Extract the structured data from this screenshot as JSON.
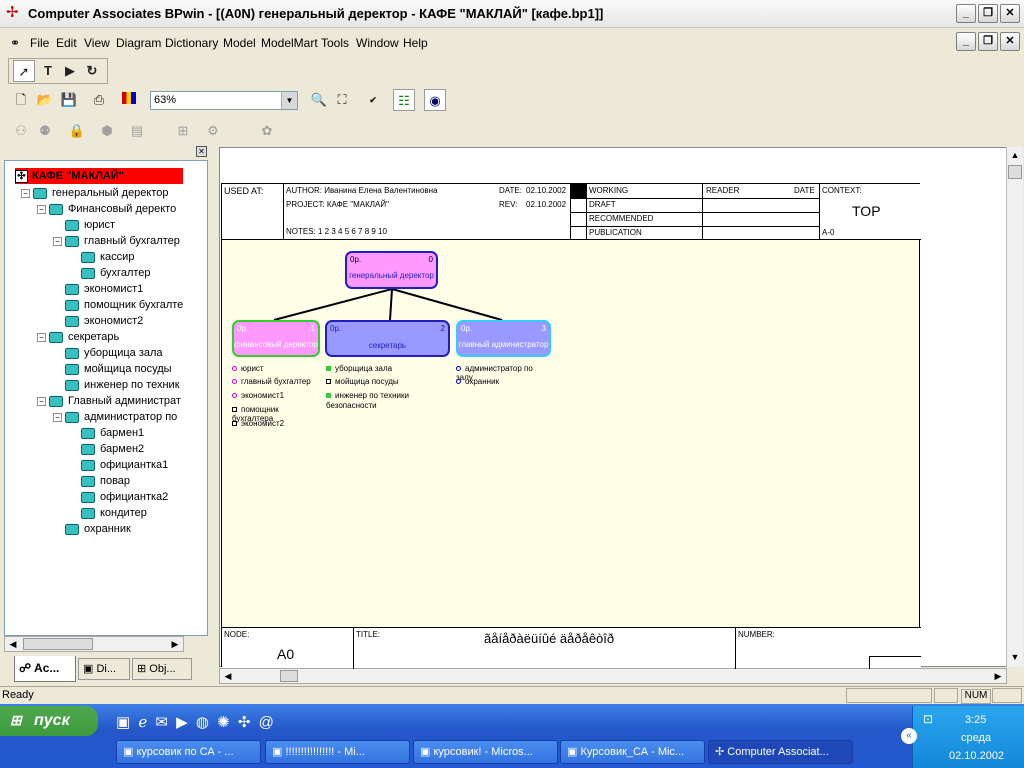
{
  "window": {
    "title": "Computer Associates BPwin - [(A0N) генеральный деректор - КАФЕ \"МАКЛАЙ\"  [кафе.bp1]]"
  },
  "menu": [
    "File",
    "Edit",
    "View",
    "Diagram",
    "Dictionary",
    "Model",
    "ModelMart",
    "Tools",
    "Window",
    "Help"
  ],
  "toolbar": {
    "zoom": "63%"
  },
  "tree": {
    "root": "КАФЕ \"МАКЛАЙ\"",
    "items": [
      {
        "label": "генеральный деректор",
        "level": 1,
        "exp": "-"
      },
      {
        "label": "Финансовый деректо",
        "level": 2,
        "exp": "-"
      },
      {
        "label": "юрист",
        "level": 3
      },
      {
        "label": "главный бухгалтер",
        "level": 3,
        "exp": "-"
      },
      {
        "label": "кассир",
        "level": 4
      },
      {
        "label": "бухгалтер",
        "level": 4
      },
      {
        "label": "экономист1",
        "level": 3
      },
      {
        "label": "помощник бухгалте",
        "level": 3
      },
      {
        "label": "экономист2",
        "level": 3
      },
      {
        "label": "секретарь",
        "level": 2,
        "exp": "-"
      },
      {
        "label": "уборщица зала",
        "level": 3
      },
      {
        "label": "мойщица посуды",
        "level": 3
      },
      {
        "label": "инженер по техник",
        "level": 3
      },
      {
        "label": "Главный администрат",
        "level": 2,
        "exp": "-"
      },
      {
        "label": "администратор по",
        "level": 3,
        "exp": "-"
      },
      {
        "label": "бармен1",
        "level": 4
      },
      {
        "label": "бармен2",
        "level": 4
      },
      {
        "label": "официантка1",
        "level": 4
      },
      {
        "label": "повар",
        "level": 4
      },
      {
        "label": "официантка2",
        "level": 4
      },
      {
        "label": "кондитер",
        "level": 4
      },
      {
        "label": "охранник",
        "level": 3
      }
    ],
    "tabs": [
      "Ac...",
      "Di...",
      "Obj..."
    ]
  },
  "frame": {
    "used_at": "USED AT:",
    "author": "AUTHOR:  Иванина Елена Валентиновна",
    "project": "PROJECT:  КАФЕ \"МАКЛАЙ\"",
    "date_label": "DATE:",
    "date": "02.10.2002",
    "rev_label": "REV:",
    "rev": "02.10.2002",
    "notes": "NOTES:  1  2  3  4  5  6  7  8  9  10",
    "status": [
      "WORKING",
      "DRAFT",
      "RECOMMENDED",
      "PUBLICATION"
    ],
    "reader": "READER",
    "reader_date": "DATE",
    "context": "CONTEXT:",
    "top": "TOP",
    "a0ref": "A-0",
    "node_label": "NODE:",
    "node": "A0",
    "title_label": "TITLE:",
    "title": "ãåíåðàëüíûé äåðåêòîð",
    "number_label": "NUMBER:"
  },
  "diagram": {
    "top_box": {
      "num": "0р.",
      "idx": "0",
      "label": "генеральный деректор"
    },
    "boxes": [
      {
        "num": "0р.",
        "idx": "1",
        "label": "финансовый деректор"
      },
      {
        "num": "0р.",
        "idx": "2",
        "label": "секретарь"
      },
      {
        "num": "0р.",
        "idx": "3",
        "label": "главный администратор"
      }
    ],
    "list1": [
      "юрист",
      "главный бухгалтер",
      "экономист1",
      "помощник бухгалтера",
      "экономист2"
    ],
    "list2": [
      "уборщица зала",
      "мойщица посуды",
      "инженер по техники безопасности"
    ],
    "list3": [
      "администратор по залу",
      "охранник"
    ]
  },
  "status": {
    "ready": "Ready",
    "num": "NUM"
  },
  "taskbar": {
    "start": "пуск",
    "tasks": [
      "курсовик по СА - ...",
      "!!!!!!!!!!!!!!!! - Mi...",
      "курсовик! - Micros...",
      "Курсовик_СА - Mic...",
      "Computer Associat..."
    ],
    "time": "3:25",
    "day": "среда",
    "date": "02.10.2002"
  }
}
